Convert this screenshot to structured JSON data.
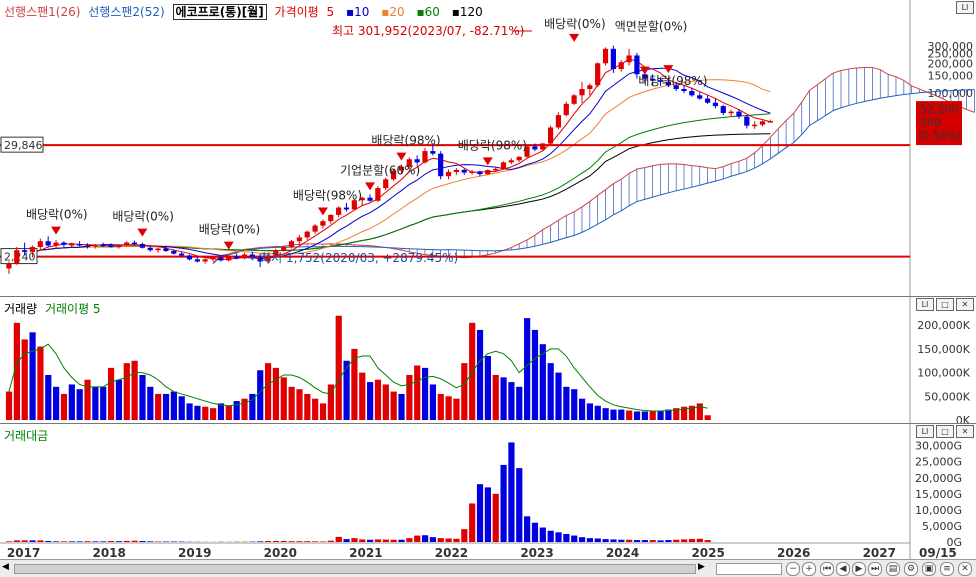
{
  "legend_main": {
    "span1": "선행스팬1(26)",
    "span2": "선행스팬2(52)",
    "stock": "에코프로(통)[월]",
    "ma_label": "가격이평",
    "ma5": "5",
    "ma10": "10",
    "ma20": "20",
    "ma60": "60",
    "ma120": "120"
  },
  "legend_volume": {
    "volume": "거래량",
    "volume_ma": "거래이평 5"
  },
  "legend_amount": {
    "amount": "거래대금"
  },
  "colors": {
    "up": "#e00000",
    "down": "#0000e0",
    "ma5": "#e00000",
    "ma10": "#0000d0",
    "ma20": "#f08030",
    "ma60": "#008000",
    "ma120": "#000000",
    "span1": "#d04040",
    "span2": "#2060c0",
    "hline": "#e00000"
  },
  "price_labels": {
    "last": "52,200",
    "change": "300",
    "change_pct": "(0.58%)"
  },
  "hline_labels": {
    "upper": "29,846",
    "lower": "2,240"
  },
  "annotations": {
    "high": "최고 301,952(2023/07, -82.71%)",
    "low": "최저 1,752(2020/03, +2879.45%)",
    "div1": "배당락(0%)",
    "div2": "배당락(0%)",
    "div3": "배당락(0%)",
    "div4": "배당락(98%)",
    "split1": "기업분할(60%)",
    "div5": "배당락(98%)",
    "div6": "배당락(98%)",
    "div7": "배당락(0%)",
    "split2": "액면분할(0%)",
    "div8": "배당락(98%)"
  },
  "date_label": "09/15",
  "chart_data": [
    {
      "type": "candlestick",
      "title": "에코프로(통)[월]",
      "y_scale": "log",
      "y_ticks": [
        "300,000",
        "250,000",
        "200,000",
        "150,000",
        "100,000"
      ],
      "candles": [
        {
          "o": 1700,
          "h": 2000,
          "l": 1500,
          "c": 1900
        },
        {
          "o": 1900,
          "h": 2800,
          "l": 1850,
          "c": 2600
        },
        {
          "o": 2600,
          "h": 3100,
          "l": 2300,
          "c": 2500
        },
        {
          "o": 2500,
          "h": 2900,
          "l": 2200,
          "c": 2800
        },
        {
          "o": 2800,
          "h": 3400,
          "l": 2600,
          "c": 3200
        },
        {
          "o": 3200,
          "h": 3600,
          "l": 2800,
          "c": 2900
        },
        {
          "o": 2900,
          "h": 3300,
          "l": 2700,
          "c": 3100
        },
        {
          "o": 3100,
          "h": 3200,
          "l": 2800,
          "c": 2950
        },
        {
          "o": 2950,
          "h": 3100,
          "l": 2800,
          "c": 3000
        },
        {
          "o": 3000,
          "h": 3200,
          "l": 2850,
          "c": 2900
        },
        {
          "o": 2900,
          "h": 3050,
          "l": 2700,
          "c": 2850
        },
        {
          "o": 2850,
          "h": 3000,
          "l": 2700,
          "c": 2950
        },
        {
          "o": 2950,
          "h": 3100,
          "l": 2800,
          "c": 2900
        },
        {
          "o": 2900,
          "h": 3050,
          "l": 2750,
          "c": 2800
        },
        {
          "o": 2800,
          "h": 3000,
          "l": 2700,
          "c": 2950
        },
        {
          "o": 2950,
          "h": 3200,
          "l": 2850,
          "c": 3100
        },
        {
          "o": 3100,
          "h": 3250,
          "l": 2900,
          "c": 3000
        },
        {
          "o": 3000,
          "h": 3100,
          "l": 2700,
          "c": 2750
        },
        {
          "o": 2750,
          "h": 2900,
          "l": 2500,
          "c": 2600
        },
        {
          "o": 2600,
          "h": 2750,
          "l": 2450,
          "c": 2700
        },
        {
          "o": 2700,
          "h": 2800,
          "l": 2500,
          "c": 2550
        },
        {
          "o": 2550,
          "h": 2650,
          "l": 2350,
          "c": 2400
        },
        {
          "o": 2400,
          "h": 2500,
          "l": 2200,
          "c": 2300
        },
        {
          "o": 2300,
          "h": 2350,
          "l": 2050,
          "c": 2100
        },
        {
          "o": 2100,
          "h": 2250,
          "l": 1950,
          "c": 2000
        },
        {
          "o": 2000,
          "h": 2150,
          "l": 1900,
          "c": 2100
        },
        {
          "o": 2100,
          "h": 2250,
          "l": 2000,
          "c": 2200
        },
        {
          "o": 2200,
          "h": 2300,
          "l": 2000,
          "c": 2050
        },
        {
          "o": 2050,
          "h": 2300,
          "l": 2000,
          "c": 2250
        },
        {
          "o": 2250,
          "h": 2400,
          "l": 2100,
          "c": 2150
        },
        {
          "o": 2150,
          "h": 2450,
          "l": 2100,
          "c": 2350
        },
        {
          "o": 2350,
          "h": 2500,
          "l": 2100,
          "c": 2200
        },
        {
          "o": 2200,
          "h": 2400,
          "l": 1752,
          "c": 2000
        },
        {
          "o": 2000,
          "h": 2400,
          "l": 1900,
          "c": 2300
        },
        {
          "o": 2300,
          "h": 2700,
          "l": 2200,
          "c": 2600
        },
        {
          "o": 2600,
          "h": 2900,
          "l": 2500,
          "c": 2800
        },
        {
          "o": 2800,
          "h": 3300,
          "l": 2700,
          "c": 3200
        },
        {
          "o": 3200,
          "h": 3700,
          "l": 3000,
          "c": 3500
        },
        {
          "o": 3500,
          "h": 4100,
          "l": 3300,
          "c": 4000
        },
        {
          "o": 4000,
          "h": 4800,
          "l": 3800,
          "c": 4600
        },
        {
          "o": 4600,
          "h": 5300,
          "l": 4300,
          "c": 5100
        },
        {
          "o": 5100,
          "h": 6000,
          "l": 4800,
          "c": 5900
        },
        {
          "o": 5900,
          "h": 7200,
          "l": 5600,
          "c": 7000
        },
        {
          "o": 7000,
          "h": 7800,
          "l": 6400,
          "c": 6700
        },
        {
          "o": 6700,
          "h": 8600,
          "l": 6500,
          "c": 8300
        },
        {
          "o": 8300,
          "h": 9000,
          "l": 7400,
          "c": 8800
        },
        {
          "o": 8800,
          "h": 9500,
          "l": 8000,
          "c": 8200
        },
        {
          "o": 8200,
          "h": 11500,
          "l": 8000,
          "c": 11000
        },
        {
          "o": 11000,
          "h": 14000,
          "l": 10500,
          "c": 13500
        },
        {
          "o": 13500,
          "h": 17000,
          "l": 13000,
          "c": 16500
        },
        {
          "o": 16500,
          "h": 19000,
          "l": 15500,
          "c": 18000
        },
        {
          "o": 18000,
          "h": 22500,
          "l": 17000,
          "c": 21500
        },
        {
          "o": 21500,
          "h": 23500,
          "l": 19000,
          "c": 20000
        },
        {
          "o": 20000,
          "h": 28000,
          "l": 19500,
          "c": 26000
        },
        {
          "o": 26000,
          "h": 30000,
          "l": 23500,
          "c": 24500
        },
        {
          "o": 24500,
          "h": 26000,
          "l": 13500,
          "c": 14500
        },
        {
          "o": 14500,
          "h": 17000,
          "l": 13500,
          "c": 16000
        },
        {
          "o": 16000,
          "h": 17500,
          "l": 15000,
          "c": 16800
        },
        {
          "o": 16800,
          "h": 17200,
          "l": 15000,
          "c": 15800
        },
        {
          "o": 15800,
          "h": 16800,
          "l": 15000,
          "c": 16200
        },
        {
          "o": 16200,
          "h": 16500,
          "l": 14500,
          "c": 15200
        },
        {
          "o": 15200,
          "h": 17000,
          "l": 15000,
          "c": 16700
        },
        {
          "o": 16700,
          "h": 17600,
          "l": 16000,
          "c": 17200
        },
        {
          "o": 17200,
          "h": 20500,
          "l": 17000,
          "c": 20000
        },
        {
          "o": 20000,
          "h": 22000,
          "l": 19200,
          "c": 21000
        },
        {
          "o": 21000,
          "h": 23000,
          "l": 20200,
          "c": 22800
        },
        {
          "o": 22800,
          "h": 30000,
          "l": 22000,
          "c": 29000
        },
        {
          "o": 29000,
          "h": 31000,
          "l": 26000,
          "c": 27000
        },
        {
          "o": 27000,
          "h": 31500,
          "l": 26000,
          "c": 31000
        },
        {
          "o": 31000,
          "h": 47000,
          "l": 30000,
          "c": 45000
        },
        {
          "o": 45000,
          "h": 64000,
          "l": 43000,
          "c": 60000
        },
        {
          "o": 60000,
          "h": 82000,
          "l": 58000,
          "c": 78000
        },
        {
          "o": 78000,
          "h": 98000,
          "l": 76000,
          "c": 95000
        },
        {
          "o": 95000,
          "h": 130000,
          "l": 80000,
          "c": 110000
        },
        {
          "o": 110000,
          "h": 125000,
          "l": 95000,
          "c": 120000
        },
        {
          "o": 120000,
          "h": 205000,
          "l": 115000,
          "c": 200000
        },
        {
          "o": 200000,
          "h": 290000,
          "l": 190000,
          "c": 280000
        },
        {
          "o": 280000,
          "h": 301952,
          "l": 160000,
          "c": 175000
        },
        {
          "o": 175000,
          "h": 215000,
          "l": 165000,
          "c": 205000
        },
        {
          "o": 205000,
          "h": 280000,
          "l": 190000,
          "c": 240000
        },
        {
          "o": 240000,
          "h": 255000,
          "l": 140000,
          "c": 155000
        },
        {
          "o": 155000,
          "h": 165000,
          "l": 125000,
          "c": 140000
        },
        {
          "o": 140000,
          "h": 155000,
          "l": 120000,
          "c": 135000
        },
        {
          "o": 135000,
          "h": 145000,
          "l": 118000,
          "c": 130000
        },
        {
          "o": 130000,
          "h": 142000,
          "l": 115000,
          "c": 120000
        },
        {
          "o": 120000,
          "h": 130000,
          "l": 105000,
          "c": 110000
        },
        {
          "o": 110000,
          "h": 120000,
          "l": 100000,
          "c": 105000
        },
        {
          "o": 105000,
          "h": 112000,
          "l": 92000,
          "c": 95000
        },
        {
          "o": 95000,
          "h": 102000,
          "l": 86000,
          "c": 88000
        },
        {
          "o": 88000,
          "h": 95000,
          "l": 78000,
          "c": 80000
        },
        {
          "o": 80000,
          "h": 88000,
          "l": 70000,
          "c": 74000
        },
        {
          "o": 74000,
          "h": 76000,
          "l": 60000,
          "c": 63000
        },
        {
          "o": 63000,
          "h": 68000,
          "l": 58000,
          "c": 65000
        },
        {
          "o": 65000,
          "h": 69000,
          "l": 55000,
          "c": 58000
        },
        {
          "o": 58000,
          "h": 60000,
          "l": 44000,
          "c": 47000
        },
        {
          "o": 47000,
          "h": 52000,
          "l": 43500,
          "c": 48000
        },
        {
          "o": 48000,
          "h": 53000,
          "l": 46000,
          "c": 51900
        },
        {
          "o": 51900,
          "h": 54000,
          "l": 50500,
          "c": 52200
        }
      ],
      "hlines": [
        29846,
        2240
      ],
      "high": 301952,
      "low": 1752
    },
    {
      "type": "bar",
      "title": "거래량",
      "y_ticks": [
        "200,000K",
        "150,000K",
        "100,000K",
        "50,000K",
        "0K"
      ],
      "ylim": [
        0,
        230000
      ],
      "values": [
        60000,
        205000,
        170000,
        185000,
        155000,
        95000,
        70000,
        55000,
        75000,
        65000,
        85000,
        70000,
        70000,
        110000,
        85000,
        120000,
        125000,
        95000,
        70000,
        55000,
        55000,
        60000,
        50000,
        35000,
        30000,
        28000,
        25000,
        35000,
        30000,
        40000,
        45000,
        55000,
        105000,
        120000,
        110000,
        90000,
        70000,
        65000,
        55000,
        45000,
        35000,
        75000,
        220000,
        125000,
        150000,
        100000,
        80000,
        85000,
        75000,
        60000,
        55000,
        95000,
        115000,
        110000,
        75000,
        55000,
        50000,
        45000,
        120000,
        205000,
        190000,
        135000,
        95000,
        90000,
        80000,
        70000,
        215000,
        190000,
        160000,
        120000,
        100000,
        70000,
        65000,
        45000,
        35000,
        30000,
        25000,
        22000,
        22000,
        20000,
        18000,
        18000,
        20000,
        20000,
        22000,
        25000,
        28000,
        30000,
        35000,
        10000
      ],
      "ma5": [
        60000,
        120000,
        140000,
        145000,
        150000,
        160000,
        140000,
        110000,
        90000,
        75000,
        70000,
        70000,
        70000,
        80000,
        85000,
        90000,
        100000,
        100000,
        95000,
        85000,
        70000,
        60000,
        55000,
        50000,
        45000,
        40000,
        35000,
        32000,
        30000,
        32000,
        36000,
        42000,
        60000,
        75000,
        85000,
        95000,
        95000,
        90000,
        80000,
        68000,
        58000,
        55000,
        85000,
        110000,
        130000,
        135000,
        135000,
        110000,
        95000,
        80000,
        72000,
        75000,
        82000,
        90000,
        92000,
        87000,
        78000,
        68000,
        75000,
        100000,
        125000,
        140000,
        145000,
        140000,
        125000,
        100000,
        115000,
        130000,
        140000,
        150000,
        150000,
        135000,
        110000,
        90000,
        70000,
        52000,
        40000,
        32000,
        28000,
        25000,
        22000,
        20000,
        19000,
        19000,
        20000,
        21000,
        23000,
        25000,
        28000,
        25000
      ],
      "up": [
        true,
        true,
        true,
        false,
        true,
        false,
        false,
        true,
        false,
        false,
        true,
        false,
        false,
        true,
        false,
        true,
        true,
        false,
        false,
        true,
        false,
        false,
        false,
        false,
        false,
        true,
        true,
        false,
        true,
        false,
        true,
        false,
        false,
        true,
        true,
        true,
        true,
        true,
        true,
        true,
        true,
        true,
        true,
        false,
        true,
        true,
        false,
        true,
        true,
        true,
        false,
        true,
        true,
        false,
        false,
        true,
        true,
        true,
        true,
        true,
        false,
        false,
        true,
        false,
        false,
        false,
        false,
        false,
        false,
        false,
        false,
        false,
        false,
        false,
        false,
        false,
        false,
        false,
        false,
        true,
        false,
        false,
        true,
        false,
        false,
        true,
        true,
        true,
        true,
        true
      ]
    },
    {
      "type": "bar",
      "title": "거래대금",
      "y_ticks": [
        "30,000G",
        "25,000G",
        "20,000G",
        "15,000G",
        "10,000G",
        "5,000G",
        "0G"
      ],
      "ylim": [
        0,
        33000
      ],
      "values": [
        200,
        500,
        500,
        500,
        500,
        300,
        200,
        200,
        200,
        200,
        250,
        200,
        200,
        300,
        250,
        350,
        400,
        300,
        200,
        150,
        150,
        150,
        130,
        80,
        70,
        60,
        50,
        70,
        60,
        80,
        100,
        120,
        200,
        300,
        300,
        300,
        250,
        250,
        250,
        200,
        150,
        400,
        1600,
        900,
        1200,
        800,
        700,
        800,
        750,
        700,
        700,
        1200,
        2000,
        2100,
        1500,
        1200,
        1100,
        1000,
        4000,
        12000,
        18000,
        17000,
        15000,
        24000,
        31000,
        23000,
        8000,
        6000,
        4500,
        3500,
        3000,
        2500,
        2000,
        1500,
        1200,
        1100,
        900,
        800,
        700,
        700,
        600,
        600,
        600,
        500,
        600,
        700,
        800,
        900,
        1000,
        600
      ],
      "up": [
        true,
        true,
        true,
        false,
        true,
        false,
        false,
        true,
        false,
        false,
        true,
        false,
        false,
        true,
        false,
        true,
        true,
        false,
        false,
        true,
        false,
        false,
        false,
        false,
        false,
        true,
        true,
        false,
        true,
        false,
        true,
        false,
        false,
        true,
        true,
        true,
        true,
        true,
        true,
        true,
        true,
        true,
        true,
        false,
        true,
        true,
        false,
        true,
        true,
        true,
        false,
        true,
        true,
        false,
        false,
        true,
        true,
        true,
        true,
        true,
        false,
        false,
        true,
        false,
        false,
        false,
        false,
        false,
        false,
        false,
        false,
        false,
        false,
        false,
        false,
        false,
        false,
        false,
        false,
        true,
        false,
        false,
        true,
        false,
        false,
        true,
        true,
        true,
        true,
        true
      ]
    }
  ],
  "x_axis": {
    "labels": [
      "2017",
      "2018",
      "2019",
      "2020",
      "2021",
      "2022",
      "2023",
      "2024",
      "2025",
      "2026",
      "2027"
    ]
  }
}
